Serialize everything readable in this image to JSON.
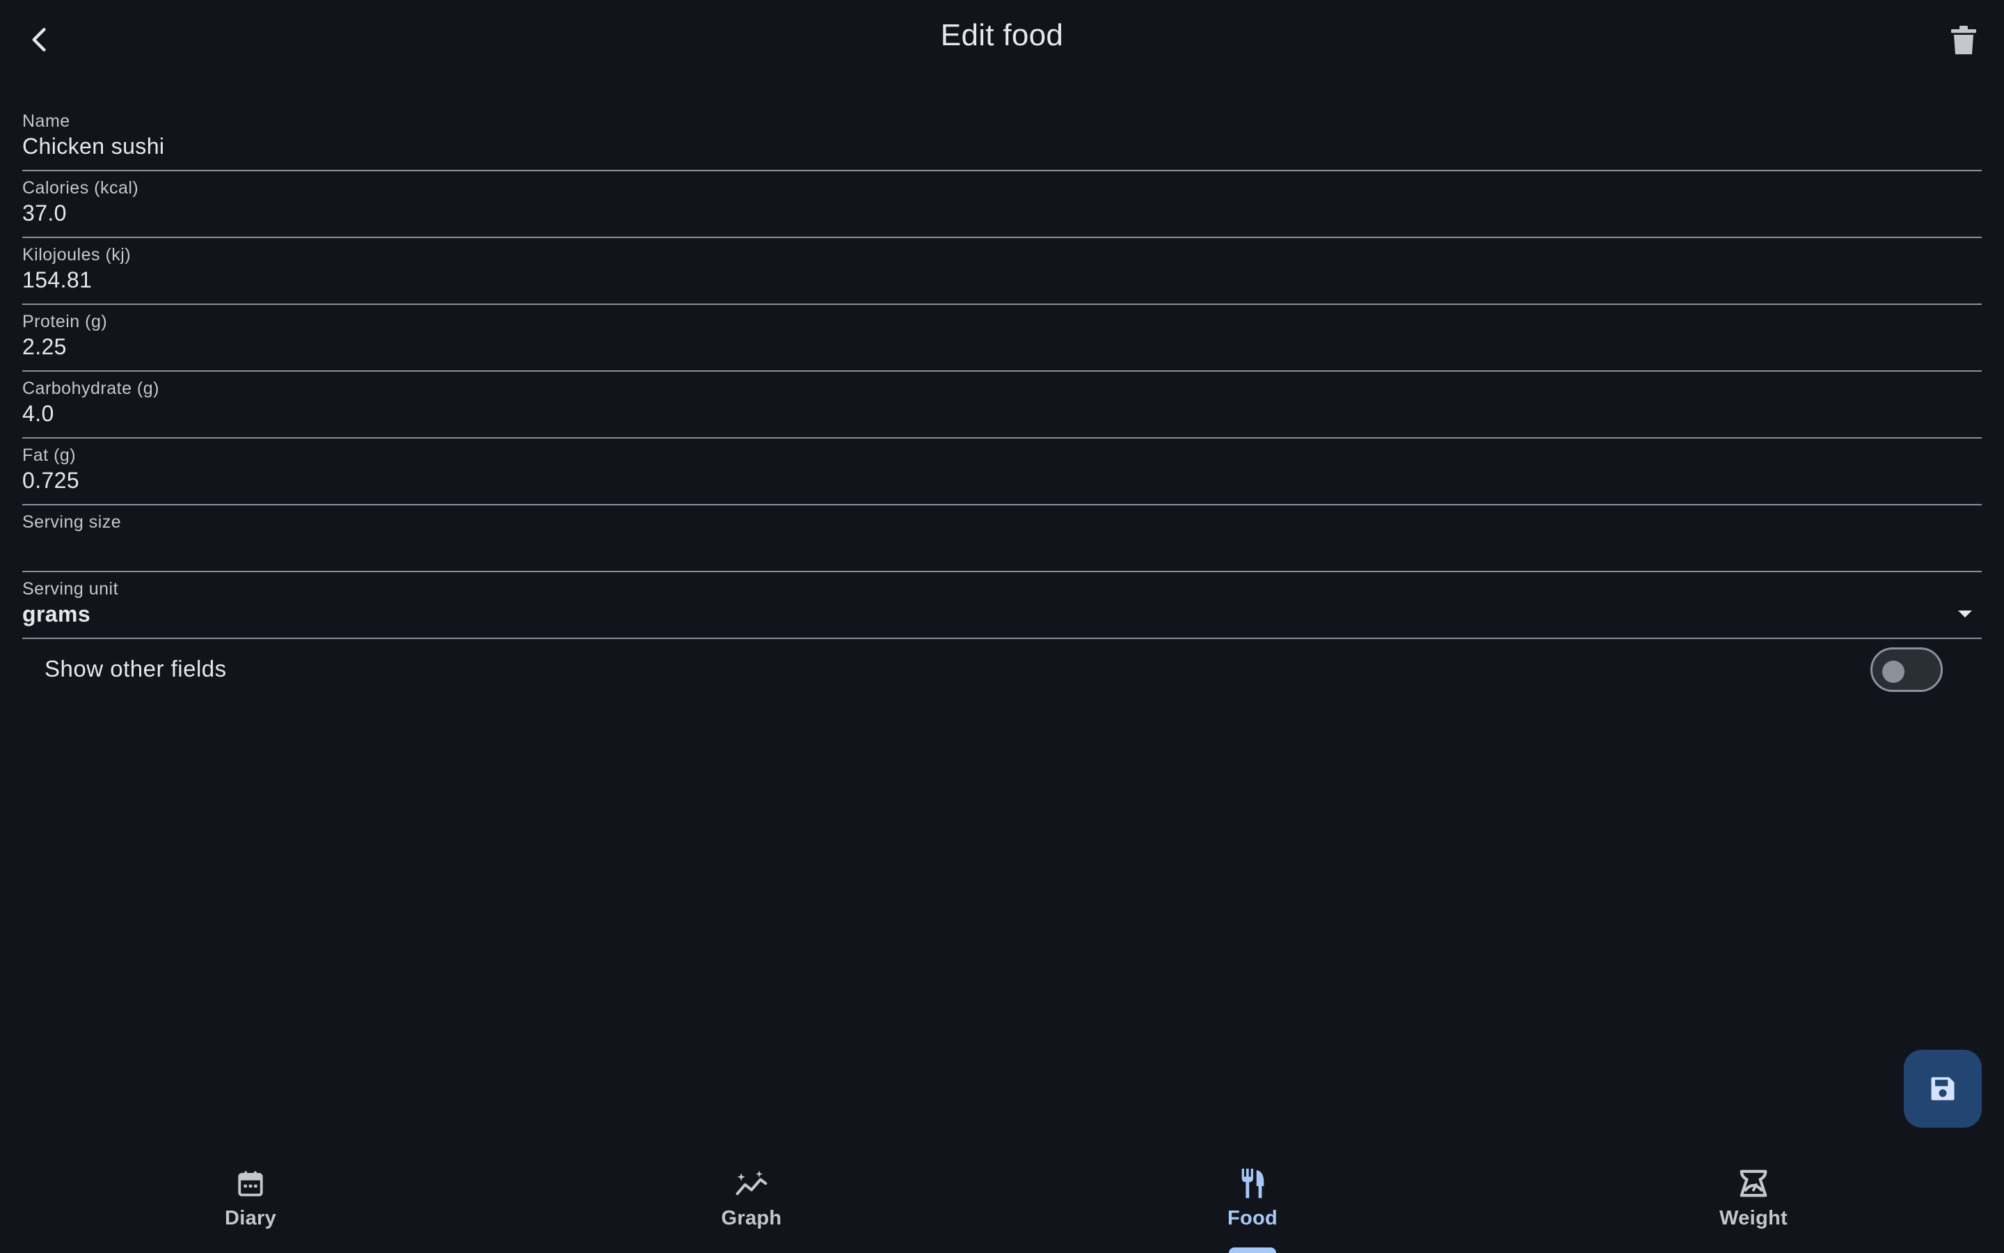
{
  "header": {
    "title": "Edit food",
    "back_icon": "arrow-back-icon",
    "delete_icon": "trash-icon"
  },
  "fields": [
    {
      "label": "Name",
      "value": "Chicken sushi"
    },
    {
      "label": "Calories (kcal)",
      "value": "37.0"
    },
    {
      "label": "Kilojoules (kj)",
      "value": "154.81"
    },
    {
      "label": "Protein (g)",
      "value": "2.25"
    },
    {
      "label": "Carbohydrate (g)",
      "value": "4.0"
    },
    {
      "label": "Fat (g)",
      "value": "0.725"
    },
    {
      "label": "Serving size",
      "value": ""
    }
  ],
  "serving_unit": {
    "label": "Serving unit",
    "value": "grams",
    "icon": "dropdown-arrow-icon"
  },
  "toggle": {
    "label": "Show other fields",
    "checked": false
  },
  "fab": {
    "icon": "save-icon"
  },
  "nav": [
    {
      "label": "Diary",
      "icon": "calendar-icon",
      "active": false
    },
    {
      "label": "Graph",
      "icon": "graph-sparkle-icon",
      "active": false
    },
    {
      "label": "Food",
      "icon": "restaurant-icon",
      "active": true
    },
    {
      "label": "Weight",
      "icon": "scale-icon",
      "active": false
    }
  ],
  "colors": {
    "background": "#11151b",
    "accent": "#a8c8f8",
    "fab": "#234572",
    "divider": "#8c9199"
  }
}
